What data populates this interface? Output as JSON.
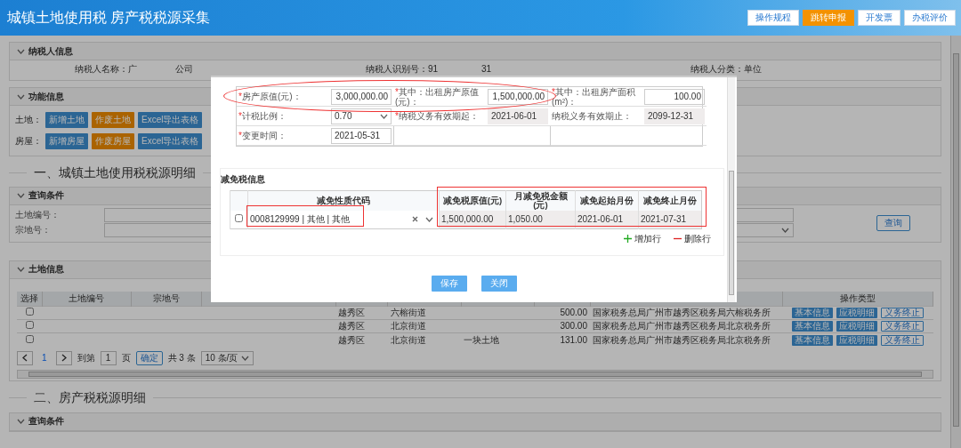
{
  "header": {
    "title": "城镇土地使用税 房产税税源采集",
    "buttons": [
      {
        "label": "操作规程",
        "kind": "plain"
      },
      {
        "label": "跳转申报",
        "kind": "accent"
      },
      {
        "label": "开发票",
        "kind": "plain"
      },
      {
        "label": "办税评价",
        "kind": "plain"
      }
    ]
  },
  "taxpayer_panel": {
    "title": "纳税人信息",
    "texts": [
      "纳税人名称：广",
      "公司",
      "纳税人识别号：91",
      "31",
      "纳税人分类：单位"
    ]
  },
  "function_panel": {
    "title": "功能信息",
    "rows": [
      {
        "label": "土地：",
        "buttons": [
          {
            "label": "新增土地",
            "kind": "primary"
          },
          {
            "label": "作废土地",
            "kind": "warning"
          },
          {
            "label": "Excel导出表格",
            "kind": "primary"
          }
        ]
      },
      {
        "label": "房屋：",
        "buttons": [
          {
            "label": "新增房屋",
            "kind": "primary"
          },
          {
            "label": "作废房屋",
            "kind": "warning"
          },
          {
            "label": "Excel导出表格",
            "kind": "primary"
          }
        ]
      }
    ]
  },
  "land_section": {
    "heading": "一、城镇土地使用税税源明细",
    "query": {
      "title": "查询条件",
      "fields": [
        {
          "label": "土地编号：",
          "kind": "input"
        },
        {
          "label": "宗地号：",
          "kind": "select"
        }
      ],
      "button": "查询"
    },
    "land_info": {
      "title": "土地信息",
      "columns": [
        "选择",
        "土地编号",
        "宗地号",
        "操作类型"
      ],
      "rows": [
        {
          "checked": false,
          "district": "越秀区",
          "street": "六榕街道",
          "area": "500.00",
          "office": "国家税务总局广州市越秀区税务局六榕税务所",
          "actions": [
            {
              "label": "基本信息",
              "kind": "filled"
            },
            {
              "label": "应税明细",
              "kind": "filled"
            },
            {
              "label": "义务终止",
              "kind": "outline"
            }
          ]
        },
        {
          "checked": false,
          "district": "越秀区",
          "street": "北京街道",
          "area": "300.00",
          "office": "国家税务总局广州市越秀区税务局北京税务所",
          "actions": [
            {
              "label": "基本信息",
              "kind": "filled"
            },
            {
              "label": "应税明细",
              "kind": "filled"
            },
            {
              "label": "义务终止",
              "kind": "outline"
            }
          ]
        },
        {
          "checked": false,
          "district": "越秀区",
          "street": "北京街道",
          "land_name": "一块土地",
          "area": "131.00",
          "office": "国家税务总局广州市越秀区税务局北京税务所",
          "actions": [
            {
              "label": "基本信息",
              "kind": "filled"
            },
            {
              "label": "应税明细",
              "kind": "filled"
            },
            {
              "label": "义务终止",
              "kind": "outline"
            }
          ]
        }
      ],
      "pagination": {
        "page": "1",
        "goto_label": "到第",
        "goto_value": "1",
        "page_unit": "页",
        "confirm": "确定",
        "total": "共 3 条",
        "page_size": "10 条/页"
      }
    }
  },
  "house_section": {
    "heading": "二、房产税税源明细",
    "query_title": "查询条件"
  },
  "dialog": {
    "rows": [
      {
        "fields": [
          {
            "marker": "*",
            "label": "房产原值(元)：",
            "kind": "number",
            "value": "3,000,000.00"
          },
          {
            "marker": "*",
            "label": "其中：出租房产原值(元)：",
            "kind": "number",
            "value": "1,500,000.00"
          },
          {
            "marker": "*",
            "label": "其中：出租房产面积(m²)：",
            "kind": "number",
            "value": "100.00"
          }
        ]
      },
      {
        "fields": [
          {
            "marker": "*",
            "label": "计税比例：",
            "kind": "select",
            "value": "0.70"
          },
          {
            "marker": "*",
            "label": "纳税义务有效期起：",
            "kind": "readonly",
            "value": "2021-06-01"
          },
          {
            "label": "纳税义务有效期止：",
            "kind": "readonly",
            "value": "2099-12-31"
          }
        ]
      },
      {
        "fields": [
          {
            "marker": "*",
            "label": "变更时间：",
            "kind": "text",
            "value": "2021-05-31"
          }
        ]
      }
    ],
    "first_row_circled": true,
    "relief": {
      "title": "减免税信息",
      "code_column": "减免性质代码",
      "value_columns": [
        "减免税原值(元)",
        "月减免税金额(元)",
        "减免起始月份",
        "减免终止月份"
      ],
      "code_highlighted": true,
      "values_highlighted": true,
      "rows": [
        {
          "checked": false,
          "code": "0008129999 | 其他 | 其他",
          "values": [
            "1,500,000.00",
            "1,050.00",
            "2021-06-01",
            "2021-07-31"
          ]
        }
      ],
      "add": "增加行",
      "remove": "删除行"
    },
    "buttons": [
      "保存",
      "关闭"
    ]
  }
}
